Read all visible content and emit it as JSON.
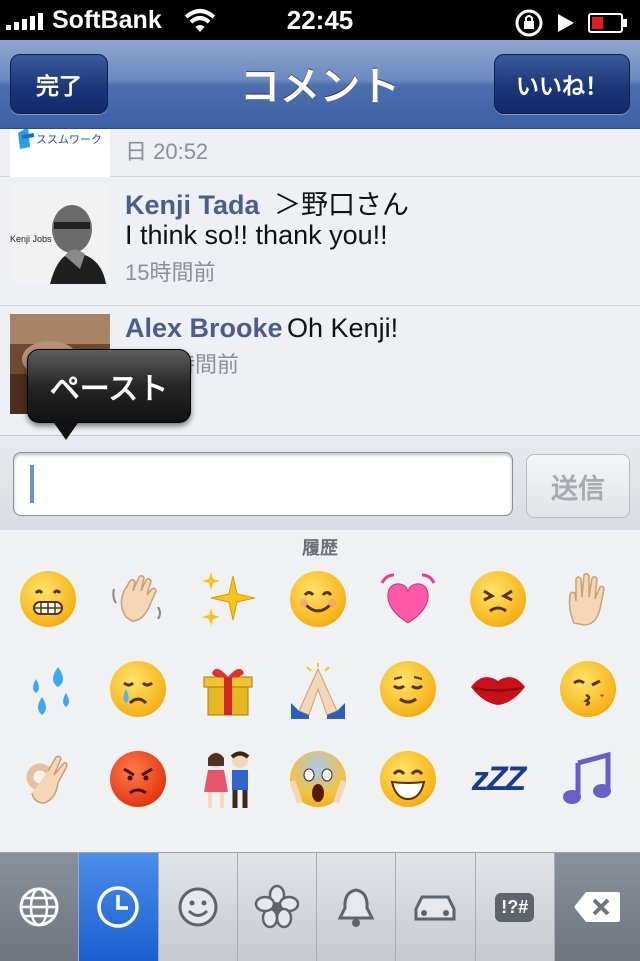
{
  "status_bar": {
    "carrier": "SoftBank",
    "time": "22:45"
  },
  "nav": {
    "done_label": "完了",
    "title": "コメント",
    "like_label": "いいね！"
  },
  "comments": [
    {
      "avatar_text": "ススムワーク",
      "name": "",
      "text": "",
      "time": "日 20:52"
    },
    {
      "avatar_text": "Kenji Jobs",
      "name": "Kenji Tada",
      "text_inline": "＞野口さん",
      "text": "I think so!! thank you!!",
      "time": "15時間前"
    },
    {
      "avatar_text": "",
      "name": "Alex Brooke",
      "text_inline": "Oh Kenji!",
      "time": "時間前"
    }
  ],
  "paste_tooltip": "ペースト",
  "input": {
    "value": "",
    "placeholder": "",
    "send_label": "送信"
  },
  "emoji_keyboard": {
    "section_label": "履歴",
    "emojis": [
      "grimacing-face",
      "waving-hand",
      "sparkles",
      "smiling-face",
      "beating-heart",
      "persevering-face",
      "raised-hand",
      "sweat-droplets",
      "crying-face",
      "gift",
      "folded-hands",
      "relieved-face",
      "kiss-mark",
      "kissing-face",
      "ok-hand",
      "angry-face",
      "couple",
      "screaming-face",
      "grinning-face",
      "zzz",
      "musical-notes"
    ],
    "zzz_text": "zZZ",
    "categories": [
      "globe-icon",
      "recent-clock-icon",
      "smiley-icon",
      "flower-icon",
      "bell-icon",
      "car-icon",
      "symbols-icon",
      "delete-icon"
    ],
    "symbols_text": "!?#"
  },
  "colors": {
    "nav_blue": "#4d6ead",
    "name_blue": "#4a5d8c",
    "active_tab": "#1b5fd0"
  }
}
